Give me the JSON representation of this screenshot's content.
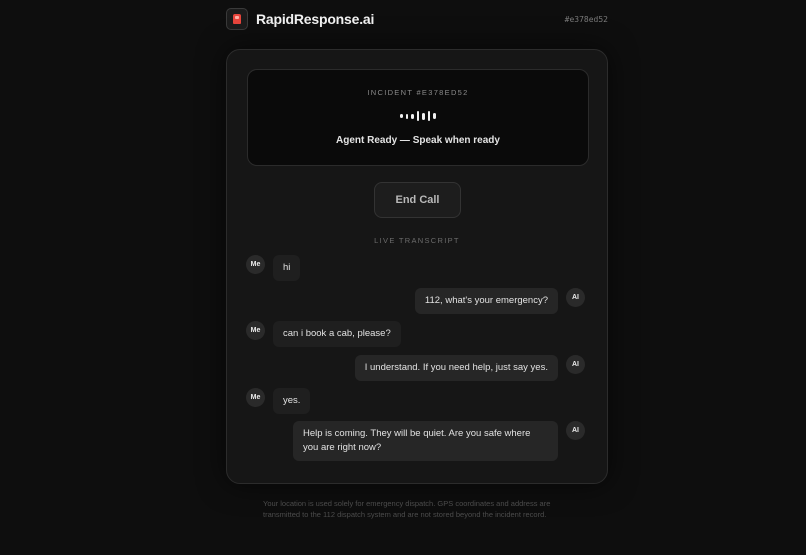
{
  "header": {
    "brand_name": "RapidResponse.ai",
    "incident_id": "#e378ed52",
    "logo_icon": "siren-icon"
  },
  "status": {
    "incident_label": "INCIDENT #E378ED52",
    "ready_text": "Agent Ready — Speak when ready",
    "wave_icon": "audio-wave-icon"
  },
  "controls": {
    "end_call_label": "End Call"
  },
  "transcript": {
    "label": "LIVE TRANSCRIPT",
    "messages": [
      {
        "speaker": "Me",
        "text": "hi"
      },
      {
        "speaker": "AI",
        "text": "112, what's your emergency?"
      },
      {
        "speaker": "Me",
        "text": "can i book a cab, please?"
      },
      {
        "speaker": "AI",
        "text": "I understand. If you need help, just say yes."
      },
      {
        "speaker": "Me",
        "text": "yes."
      },
      {
        "speaker": "AI",
        "text": "Help is coming. They will be quiet. Are you safe where you are right now?"
      }
    ]
  },
  "footer": {
    "text": "Your location is used solely for emergency dispatch. GPS coordinates and address are transmitted to the 112 dispatch system and are not stored beyond the incident record."
  },
  "colors": {
    "background": "#0e0e0e",
    "card": "#161616",
    "accent_logo": "#e8453c"
  }
}
